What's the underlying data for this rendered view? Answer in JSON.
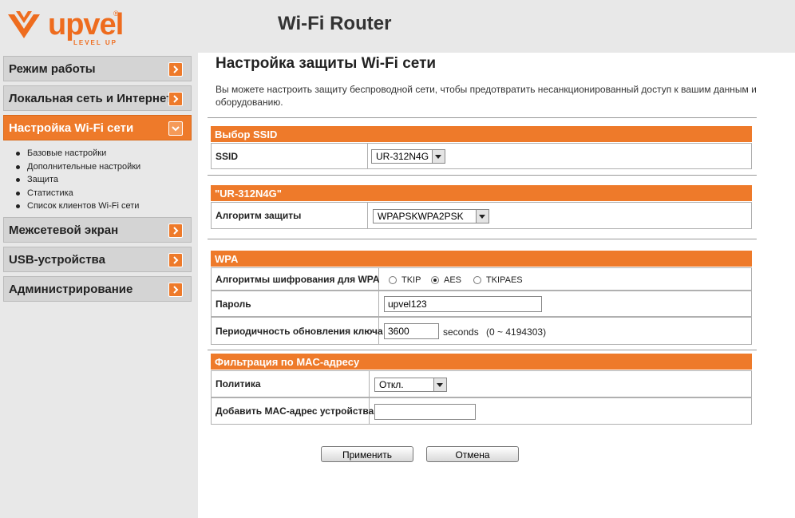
{
  "brand": {
    "logo_text": "upvel",
    "logo_tagline": "LEVEL UP",
    "logo_reg": "®",
    "product": "Wi-Fi Router"
  },
  "sidebar": {
    "items": [
      {
        "label": "Режим работы"
      },
      {
        "label": "Локальная сеть и Интернет"
      },
      {
        "label": "Настройка Wi-Fi сети"
      },
      {
        "label": "Межсетевой экран"
      },
      {
        "label": "USB-устройства"
      },
      {
        "label": "Администрирование"
      }
    ],
    "active_index": 2,
    "submenu": [
      "Базовые настройки",
      "Дополнительные настройки",
      "Защита",
      "Статистика",
      "Список клиентов Wi-Fi сети"
    ]
  },
  "main": {
    "title": "Настройка защиты Wi-Fi сети",
    "description": "Вы можете настроить защиту беспроводной сети, чтобы предотвратить несанкционированный доступ к вашим данным и оборудованию.",
    "ssid_section": {
      "header": "Выбор SSID",
      "label": "SSID",
      "value": "UR-312N4G"
    },
    "security_section": {
      "header": "\"UR-312N4G\"",
      "label": "Алгоритм защиты",
      "value": "WPAPSKWPA2PSK"
    },
    "wpa_section": {
      "header": "WPA",
      "cipher_label": "Алгоритмы шифрования для WPA",
      "cipher_options": [
        "TKIP",
        "AES",
        "TKIPAES"
      ],
      "cipher_selected": "AES",
      "password_label": "Пароль",
      "password_value": "upvel123",
      "rekey_label": "Периодичность обновления ключа",
      "rekey_value": "3600",
      "rekey_unit": "seconds",
      "rekey_range": "(0 ~ 4194303)"
    },
    "mac_section": {
      "header": "Фильтрация по MAC-адресу",
      "policy_label": "Политика",
      "policy_value": "Откл.",
      "add_label": "Добавить MAC-адрес устройства",
      "add_value": ""
    },
    "buttons": {
      "apply": "Применить",
      "cancel": "Отмена"
    }
  },
  "colors": {
    "accent": "#ee7a2a",
    "sidebar_bg": "#e8e8e8"
  }
}
